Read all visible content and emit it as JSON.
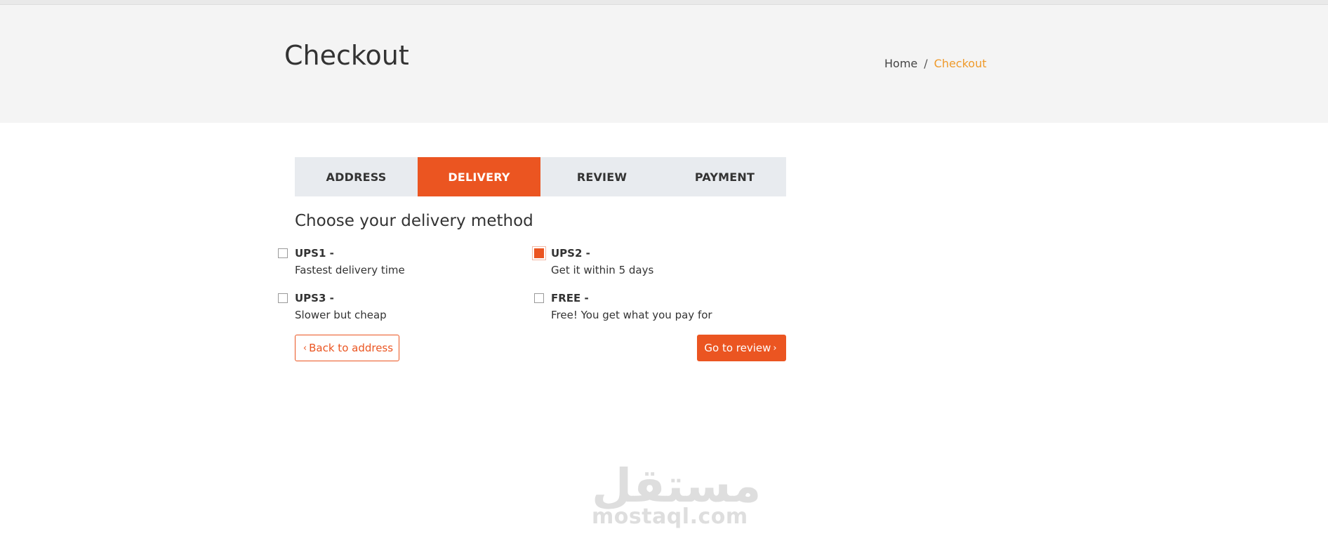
{
  "header": {
    "title": "Checkout",
    "breadcrumb": {
      "home": "Home",
      "separator": "/",
      "current": "Checkout"
    }
  },
  "tabs": [
    {
      "label": "ADDRESS",
      "active": false
    },
    {
      "label": "DELIVERY",
      "active": true
    },
    {
      "label": "REVIEW",
      "active": false
    },
    {
      "label": "PAYMENT",
      "active": false
    }
  ],
  "delivery": {
    "title": "Choose your delivery method",
    "options": [
      {
        "name": "UPS1 -",
        "description": "Fastest delivery time",
        "checked": false
      },
      {
        "name": "UPS2 -",
        "description": "Get it within 5 days",
        "checked": true
      },
      {
        "name": "UPS3 -",
        "description": "Slower but cheap",
        "checked": false
      },
      {
        "name": "FREE -",
        "description": "Free! You get what you pay for",
        "checked": false
      }
    ]
  },
  "actions": {
    "back_label": "Back to address",
    "back_icon": "chevron-left-icon",
    "next_label": "Go to review",
    "next_icon": "chevron-right-icon"
  },
  "watermark": {
    "arabic": "مستقل",
    "latin": "mostaql.com"
  },
  "colors": {
    "accent": "#eb5521",
    "breadcrumb_active": "#ef9a2a",
    "heading_bg": "#f4f4f4",
    "tab_bg": "#e8ebef"
  }
}
